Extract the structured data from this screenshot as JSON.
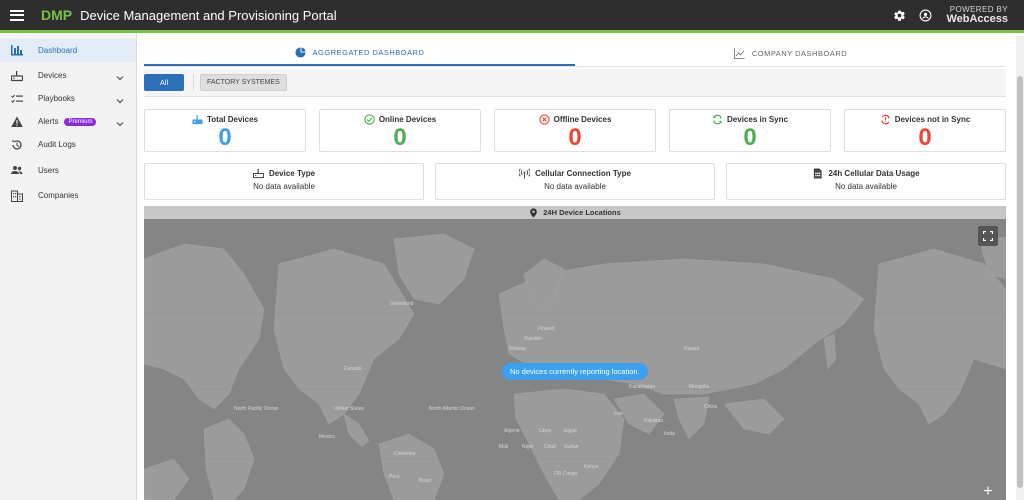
{
  "header": {
    "brand": "DMP",
    "title": "Device Management and Provisioning Portal",
    "powered_line1": "POWERED BY",
    "powered_line2": "WebAccess",
    "icons": [
      "menu-icon",
      "settings-icon",
      "account-icon"
    ],
    "accent": "#7ac143",
    "bar_color": "#2e2e2e"
  },
  "sidebar": {
    "items": [
      {
        "label": "Dashboard",
        "icon": "bar-chart-icon",
        "active": true
      },
      {
        "label": "Devices",
        "icon": "router-icon",
        "expandable": true
      },
      {
        "label": "Playbooks",
        "icon": "checklist-icon",
        "expandable": true
      },
      {
        "label": "Alerts",
        "icon": "warning-icon",
        "expandable": true,
        "badge": "Premium"
      },
      {
        "label": "Audit Logs",
        "icon": "history-icon"
      },
      {
        "label": "Users",
        "icon": "people-icon"
      },
      {
        "label": "Companies",
        "icon": "building-icon"
      }
    ]
  },
  "tabs": [
    {
      "label": "AGGREGATED DASHBOARD",
      "icon": "pie-chart-icon",
      "active": true
    },
    {
      "label": "COMPANY DASHBOARD",
      "icon": "line-chart-icon",
      "active": false
    }
  ],
  "filters": {
    "all_label": "All",
    "items": [
      "FACTORY SYSTEMES"
    ]
  },
  "stats": [
    {
      "label": "Total Devices",
      "value": "0",
      "color": "#3d9ff0",
      "icon": "device-icon"
    },
    {
      "label": "Online Devices",
      "value": "0",
      "color": "#4caf50",
      "icon": "check-circle-icon"
    },
    {
      "label": "Offline Devices",
      "value": "0",
      "color": "#f44336",
      "icon": "cancel-circle-icon"
    },
    {
      "label": "Devices in Sync",
      "value": "0",
      "color": "#4caf50",
      "icon": "sync-icon"
    },
    {
      "label": "Devices not in Sync",
      "value": "0",
      "color": "#f44336",
      "icon": "sync-problem-icon"
    }
  ],
  "info_cards": [
    {
      "label": "Device Type",
      "sub": "No data available",
      "icon": "router-icon"
    },
    {
      "label": "Cellular Connection Type",
      "sub": "No data available",
      "icon": "antenna-icon"
    },
    {
      "label": "24h Cellular Data Usage",
      "sub": "No data available",
      "icon": "sim-card-icon"
    }
  ],
  "map": {
    "title": "24H Device Locations",
    "message": "No devices currently reporting location.",
    "labels": [
      "Greenland",
      "Canada",
      "Finland",
      "Norway",
      "Sweden",
      "United States",
      "Algeria",
      "Libya",
      "Egypt",
      "Mongolia",
      "Kazakhstan",
      "China",
      "India",
      "Pakistan",
      "Iran",
      "Sudan",
      "Chad",
      "Niger",
      "Mali",
      "Brazil",
      "Peru",
      "Colombia",
      "DR Congo",
      "Kenya",
      "Mexico",
      "Russia",
      "North Atlantic Ocean",
      "North Pacific Ocean"
    ]
  }
}
